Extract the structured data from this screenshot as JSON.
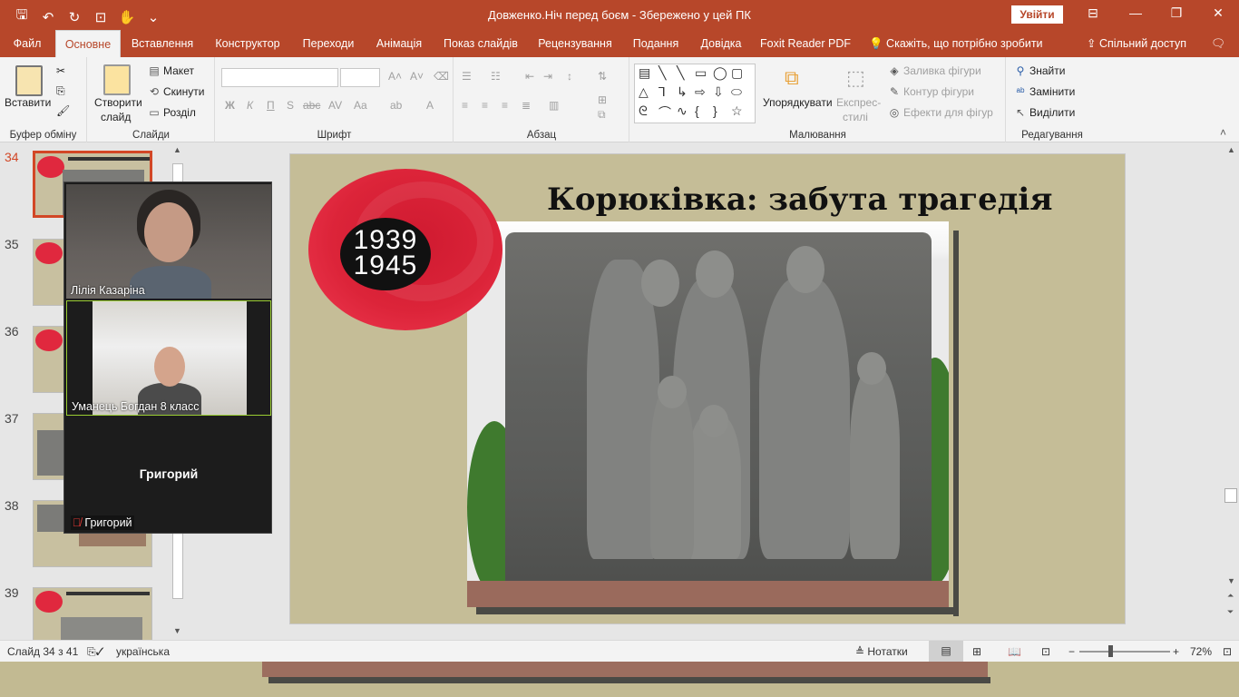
{
  "window": {
    "title": "Довженко.Ніч перед боєм  -  Збережено у цей ПК",
    "signin_label": "Увійти"
  },
  "tabs": [
    "Файл",
    "Основне",
    "Вставлення",
    "Конструктор",
    "Переходи",
    "Анімація",
    "Показ слайдів",
    "Рецензування",
    "Подання",
    "Довідка",
    "Foxit Reader PDF"
  ],
  "tell_me": "Скажіть, що потрібно зробити",
  "share": "Спільний доступ",
  "ribbon": {
    "clipboard": {
      "paste": "Вставити",
      "label": "Буфер обміну"
    },
    "slides": {
      "new_slide_1": "Створити",
      "new_slide_2": "слайд",
      "layout": "Макет",
      "reset": "Скинути",
      "section": "Розділ",
      "label": "Слайди"
    },
    "font": {
      "label": "Шрифт",
      "bold": "Ж",
      "italic": "К",
      "underline": "П",
      "shadow": "S",
      "strike": "abc",
      "spacing": "AV",
      "case": "Aa"
    },
    "paragraph": {
      "label": "Абзац"
    },
    "drawing": {
      "arrange": "Упорядкувати",
      "quick_styles_1": "Експрес-",
      "quick_styles_2": "стилі",
      "fill": "Заливка фігури",
      "outline": "Контур фігури",
      "effects": "Ефекти для фігур",
      "label": "Малювання"
    },
    "editing": {
      "find": "Знайти",
      "replace": "Замінити",
      "select": "Виділити",
      "label": "Редагування"
    }
  },
  "thumbnails": [
    {
      "num": "34",
      "selected": true
    },
    {
      "num": "35",
      "selected": false
    },
    {
      "num": "36",
      "selected": false
    },
    {
      "num": "37",
      "selected": false
    },
    {
      "num": "38",
      "selected": false
    },
    {
      "num": "39",
      "selected": false
    }
  ],
  "slide": {
    "title": "Корюківка: забута трагедія",
    "year_top": "1939",
    "year_bottom": "1945"
  },
  "video_call": {
    "participant1": "Лілія Казаріна",
    "participant2": "Уманець Богдан 8 класс",
    "participant3_big": "Григорий",
    "participant3": "Григорий"
  },
  "status": {
    "slide_info": "Слайд 34 з 41",
    "language": "українська",
    "notes": "Нотатки",
    "zoom": "72%"
  },
  "colors": {
    "accent": "#b7472a",
    "slide_bg": "#c5bd97",
    "red_circle": "#dc2439"
  }
}
